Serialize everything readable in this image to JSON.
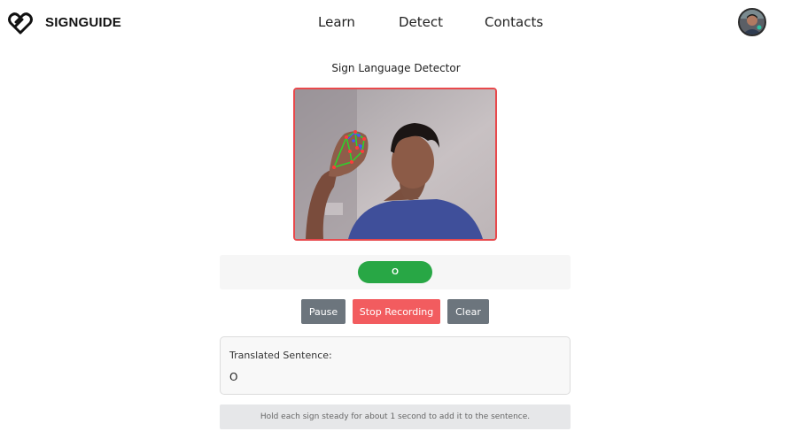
{
  "brand": {
    "name": "SIGNGUIDE",
    "logo_icon": "heart-hands-logo-icon"
  },
  "nav": {
    "links": [
      "Learn",
      "Detect",
      "Contacts"
    ],
    "avatar_icon": "user-avatar"
  },
  "main": {
    "title": "Sign Language Detector",
    "video": {
      "description_icon": "webcam-feed",
      "border_color": "#e8494c"
    },
    "prediction": {
      "label": "O",
      "color": "#28a745"
    },
    "controls": {
      "pause_label": "Pause",
      "stop_label": "Stop Recording",
      "clear_label": "Clear"
    },
    "sentence": {
      "label": "Translated Sentence:",
      "value": "O"
    },
    "hint": "Hold each sign steady for about 1 second to add it to the sentence."
  },
  "colors": {
    "accent_red": "#f25c5f",
    "button_gray": "#6c757d",
    "success_green": "#28a745"
  }
}
